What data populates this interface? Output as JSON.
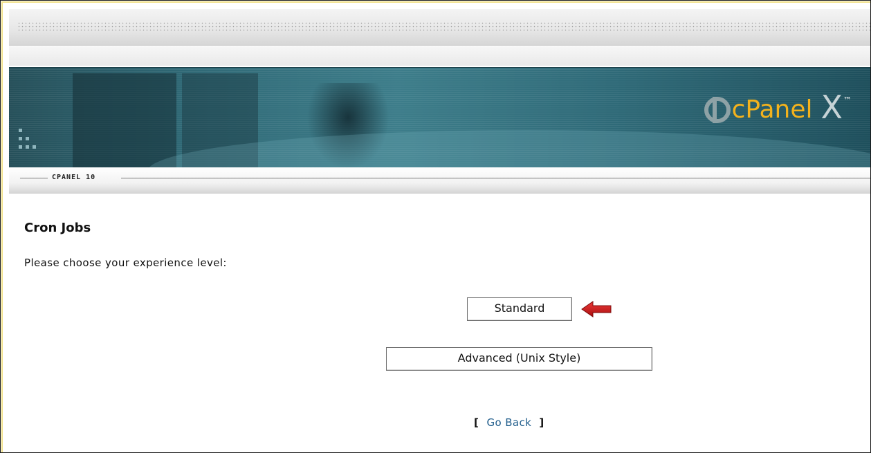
{
  "brand": {
    "product": "cPanel",
    "version_mark": "X",
    "trademark": "™",
    "accent": "#f3b21d"
  },
  "nav": {
    "label": "CPANEL 10"
  },
  "page": {
    "title": "Cron Jobs",
    "prompt": "Please choose your experience level:"
  },
  "options": {
    "standard_label": "Standard",
    "advanced_label": "Advanced (Unix Style)"
  },
  "goback": {
    "open_bracket": "[",
    "link_label": "Go Back",
    "close_bracket": "]"
  },
  "annotation": {
    "arrow_color": "#cc1a1a",
    "icon": "red-arrow-left-icon"
  }
}
